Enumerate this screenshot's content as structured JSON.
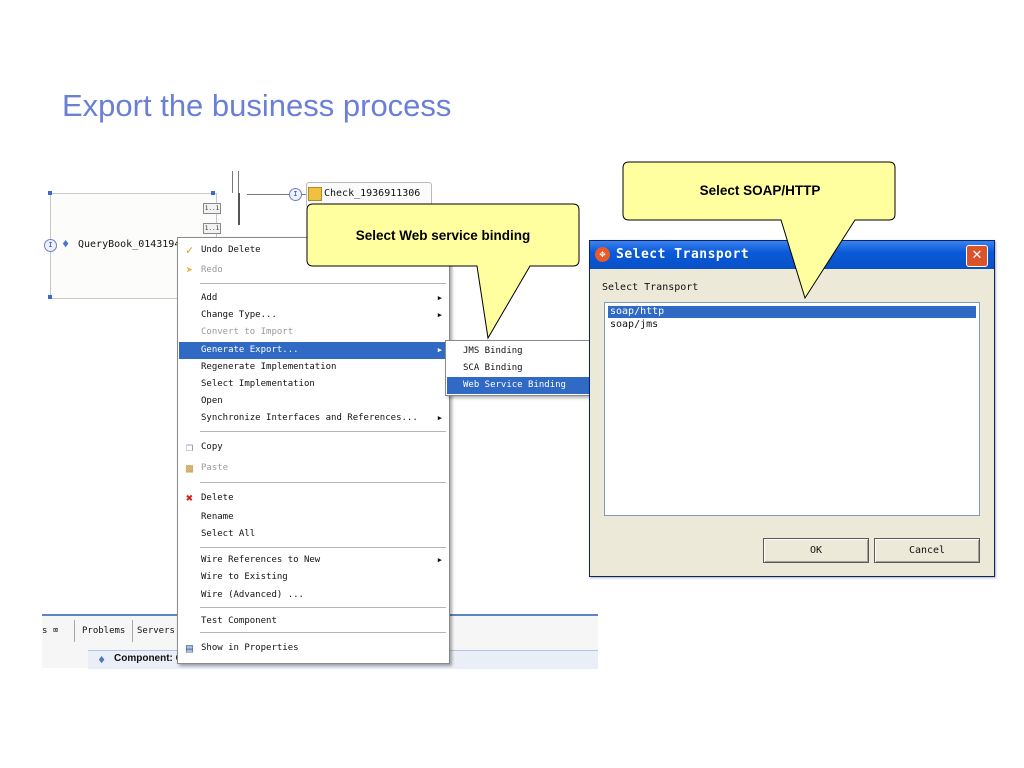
{
  "slide": {
    "title": "Export the business process"
  },
  "diagram": {
    "component_label": "QueryBook_0143194",
    "target_label": "Check_1936911306",
    "multiplicity": "1..1",
    "interface_glyph": "I"
  },
  "context_menu": {
    "items": [
      {
        "label": "Undo Delete",
        "icon": "undo-icon",
        "enabled": true
      },
      {
        "label": "Redo",
        "icon": "redo-icon",
        "enabled": false
      },
      {
        "label": "Add",
        "submenu": true,
        "enabled": true
      },
      {
        "label": "Change Type...",
        "submenu": true,
        "enabled": true
      },
      {
        "label": "Convert to Import",
        "enabled": false
      },
      {
        "label": "Generate Export...",
        "submenu": true,
        "enabled": true,
        "highlighted": true
      },
      {
        "label": "Regenerate Implementation",
        "enabled": true
      },
      {
        "label": "Select Implementation",
        "enabled": true
      },
      {
        "label": "Open",
        "enabled": true
      },
      {
        "label": "Synchronize Interfaces and References...",
        "submenu": true,
        "enabled": true
      },
      {
        "label": "Copy",
        "icon": "copy-icon",
        "enabled": true
      },
      {
        "label": "Paste",
        "icon": "paste-icon",
        "enabled": false
      },
      {
        "label": "Delete",
        "icon": "delete-icon",
        "enabled": true
      },
      {
        "label": "Rename",
        "enabled": true
      },
      {
        "label": "Select All",
        "enabled": true
      },
      {
        "label": "Wire References to New",
        "submenu": true,
        "enabled": true
      },
      {
        "label": "Wire to Existing",
        "enabled": true
      },
      {
        "label": "Wire (Advanced) ...",
        "enabled": true
      },
      {
        "label": "Test Component",
        "enabled": true
      },
      {
        "label": "Show in Properties",
        "icon": "properties-icon",
        "enabled": true
      }
    ]
  },
  "submenu": {
    "items": [
      {
        "label": "JMS Binding"
      },
      {
        "label": "SCA Binding"
      },
      {
        "label": "Web Service Binding",
        "highlighted": true
      }
    ]
  },
  "callouts": {
    "web_service": "Select Web service binding",
    "soap": "Select SOAP/HTTP"
  },
  "dialog": {
    "title": "Select Transport",
    "label": "Select Transport",
    "options": [
      "soap/http",
      "soap/jms"
    ],
    "selected": "soap/http",
    "ok": "OK",
    "cancel": "Cancel"
  },
  "bottom_panel": {
    "tabs": [
      "s ⌧",
      "Problems",
      "Servers"
    ],
    "component_text": "Component: QueryBook (Process)"
  },
  "colors": {
    "title": "#6a7fd6",
    "callout_fill": "#ffffa0",
    "menu_highlight": "#316ac5",
    "dialog_titlebar": "#0a5ad8"
  }
}
